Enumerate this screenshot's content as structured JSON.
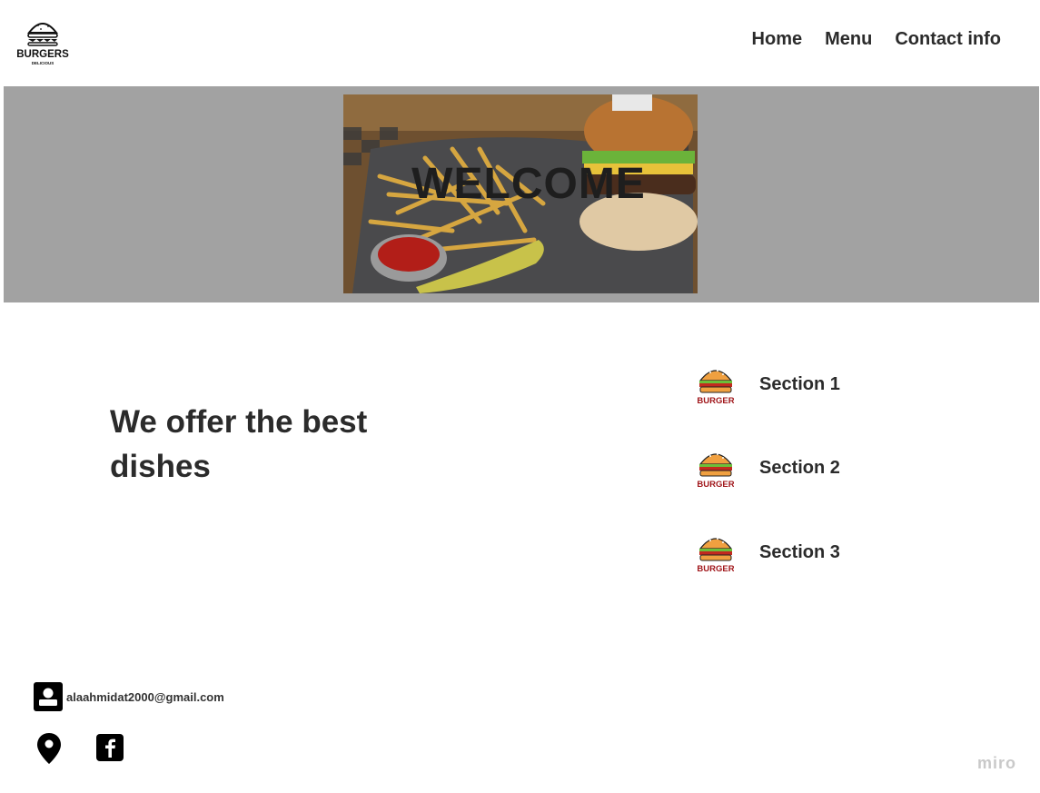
{
  "header": {
    "logo": {
      "brand": "BURGERS",
      "sub": "DELICIOUS",
      "icon": "burger-logo-icon"
    },
    "nav": [
      {
        "label": "Home"
      },
      {
        "label": "Menu"
      },
      {
        "label": "Contact info"
      }
    ]
  },
  "hero": {
    "title": "WELCOME",
    "image": "burger-and-fries-photo",
    "background_color": "#a2a2a2"
  },
  "main": {
    "tagline": "We offer the best dishes",
    "sections": [
      {
        "label": "Section 1",
        "icon_text": "BURGER",
        "icon": "burger-icon"
      },
      {
        "label": "Section 2",
        "icon_text": "BURGER",
        "icon": "burger-icon"
      },
      {
        "label": "Section 3",
        "icon_text": "BURGER",
        "icon": "burger-icon"
      }
    ]
  },
  "footer": {
    "email": "alaahmidat2000@gmail.com",
    "icons": [
      "contact-icon",
      "location-pin-icon",
      "facebook-icon"
    ],
    "watermark": "miro"
  }
}
